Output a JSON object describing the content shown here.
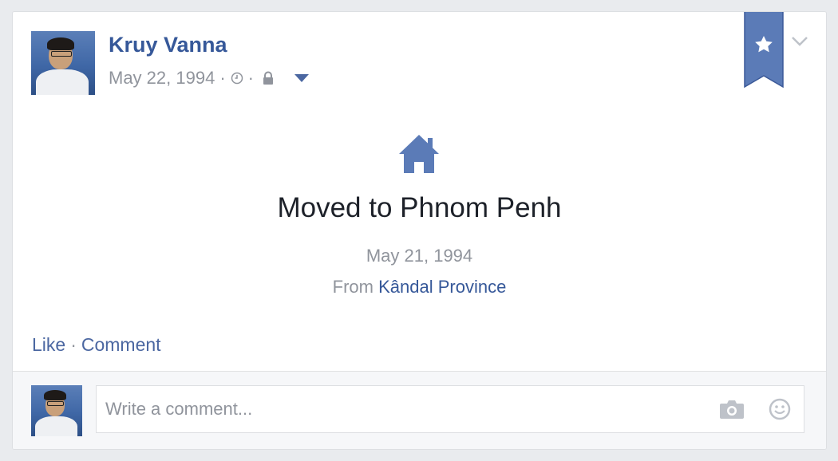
{
  "post": {
    "author_name": "Kruy Vanna",
    "date": "May 22, 1994",
    "separator": "·"
  },
  "life_event": {
    "icon": "house-icon",
    "title": "Moved to Phnom Penh",
    "date": "May 21, 1994",
    "from_prefix": "From",
    "from_place": "Kândal Province"
  },
  "actions": {
    "like_label": "Like",
    "separator": "·",
    "comment_label": "Comment"
  },
  "comment_composer": {
    "placeholder": "Write a comment...",
    "value": ""
  },
  "colors": {
    "link_blue": "#365899",
    "accent": "#5b7bb7",
    "muted": "#90949c",
    "text": "#1d2129"
  }
}
